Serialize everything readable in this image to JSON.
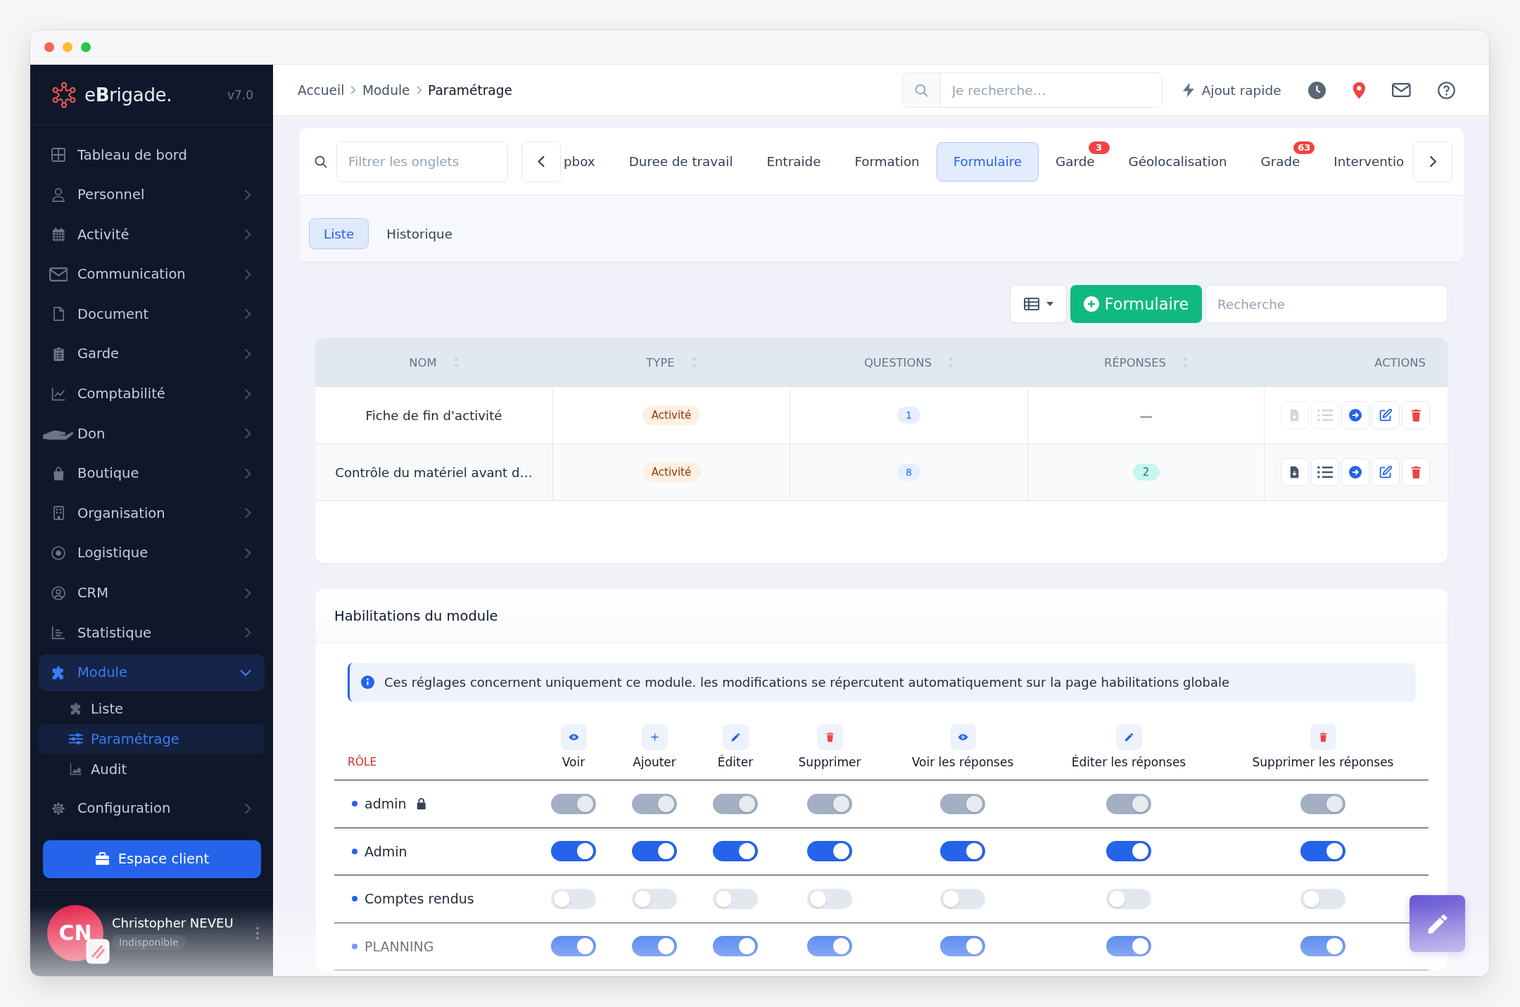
{
  "sidebar": {
    "logo": "e**B**rigade.",
    "version": "v7.0",
    "items": [
      {
        "label": "Tableau de bord",
        "kind": "link",
        "selected": false
      },
      {
        "label": "Personnel",
        "kind": "group",
        "expanded": false,
        "selected": false
      },
      {
        "label": "Activité",
        "kind": "group",
        "expanded": false,
        "selected": false
      },
      {
        "label": "Communication",
        "kind": "group",
        "expanded": false,
        "selected": false
      },
      {
        "label": "Document",
        "kind": "group",
        "expanded": false,
        "selected": false
      },
      {
        "label": "Garde",
        "kind": "group",
        "expanded": false,
        "selected": false
      },
      {
        "label": "Comptabilité",
        "kind": "group",
        "expanded": false,
        "selected": false
      },
      {
        "label": "Don",
        "kind": "group",
        "expanded": false,
        "selected": false
      },
      {
        "label": "Boutique",
        "kind": "group",
        "expanded": false,
        "selected": false
      },
      {
        "label": "Organisation",
        "kind": "group",
        "expanded": false,
        "selected": false
      },
      {
        "label": "Logistique",
        "kind": "group",
        "expanded": false,
        "selected": false
      },
      {
        "label": "CRM",
        "kind": "group",
        "expanded": false,
        "selected": false
      },
      {
        "label": "Statistique",
        "kind": "group",
        "expanded": false,
        "selected": false
      },
      {
        "label": "Module",
        "kind": "group",
        "expanded": true,
        "selected": true,
        "children": [
          {
            "label": "Liste",
            "selected": false
          },
          {
            "label": "Paramétrage",
            "selected": true
          },
          {
            "label": "Audit",
            "selected": false
          }
        ]
      },
      {
        "label": "Configuration",
        "kind": "group",
        "expanded": false,
        "selected": false
      }
    ],
    "client_button": "Espace client",
    "user": {
      "initials": "CN",
      "name": "Christopher NEVEU",
      "status": "Indisponible"
    }
  },
  "topbar": {
    "breadcrumbs": [
      "Accueil",
      "Module",
      "Paramétrage"
    ],
    "search": {
      "placeholder": "Je recherche…"
    },
    "quick_add": "Ajout rapide"
  },
  "module_tabs": {
    "filter": {
      "placeholder": "Filtrer les onglets"
    },
    "items": [
      {
        "label": "pbox",
        "selected": false
      },
      {
        "label": "Duree de travail",
        "selected": false
      },
      {
        "label": "Entraide",
        "selected": false
      },
      {
        "label": "Formation",
        "selected": false
      },
      {
        "label": "Formulaire",
        "selected": true
      },
      {
        "label": "Garde",
        "selected": false,
        "badge": "3"
      },
      {
        "label": "Géolocalisation",
        "selected": false
      },
      {
        "label": "Grade",
        "selected": false,
        "badge": "63"
      },
      {
        "label": "Interventio",
        "selected": false
      }
    ],
    "subtabs": [
      {
        "label": "Liste",
        "selected": true
      },
      {
        "label": "Historique",
        "selected": false
      }
    ]
  },
  "toolbar": {
    "add_button": "Formulaire",
    "search": {
      "placeholder": "Recherche"
    }
  },
  "table": {
    "columns": [
      {
        "label": "NOM",
        "sortable": true
      },
      {
        "label": "TYPE",
        "sortable": true
      },
      {
        "label": "QUESTIONS",
        "sortable": true
      },
      {
        "label": "RÉPONSES",
        "sortable": true
      },
      {
        "label": "ACTIONS",
        "sortable": false
      }
    ],
    "rows": [
      {
        "name": "Fiche de fin d'activité",
        "type": "Activité",
        "questions": "1",
        "responses": {
          "kind": "plain",
          "text": "—"
        },
        "actions": [
          {
            "disabled": true
          },
          {
            "disabled": true
          },
          {
            "disabled": false
          },
          {
            "disabled": false
          },
          {
            "disabled": false
          }
        ]
      },
      {
        "name": "Contrôle du matériel avant d…",
        "type": "Activité",
        "questions": "8",
        "responses": {
          "kind": "badge",
          "text": "2"
        },
        "actions": [
          {
            "disabled": false
          },
          {
            "disabled": false
          },
          {
            "disabled": false
          },
          {
            "disabled": false
          },
          {
            "disabled": false
          }
        ]
      }
    ]
  },
  "permissions": {
    "title": "Habilitations du module",
    "info": "Ces réglages concernent uniquement ce module. les modifications se répercutent automatiquement sur la page habilitations globale",
    "role_heading": "RÔLE",
    "columns": [
      {
        "label": "Voir",
        "kind": "view"
      },
      {
        "label": "Ajouter",
        "kind": "add"
      },
      {
        "label": "Éditer",
        "kind": "edit"
      },
      {
        "label": "Supprimer",
        "kind": "delete"
      },
      {
        "label": "Voir les réponses",
        "kind": "view"
      },
      {
        "label": "Éditer les réponses",
        "kind": "edit"
      },
      {
        "label": "Supprimer les réponses",
        "kind": "delete"
      }
    ],
    "roles": [
      {
        "name": "admin",
        "locked": true,
        "permissions": [
          {
            "on": true,
            "disabled": true
          },
          {
            "on": true,
            "disabled": true
          },
          {
            "on": true,
            "disabled": true
          },
          {
            "on": true,
            "disabled": true
          },
          {
            "on": true,
            "disabled": true
          },
          {
            "on": true,
            "disabled": true
          },
          {
            "on": true,
            "disabled": true
          }
        ]
      },
      {
        "name": "Admin",
        "locked": false,
        "permissions": [
          {
            "on": true,
            "disabled": false
          },
          {
            "on": true,
            "disabled": false
          },
          {
            "on": true,
            "disabled": false
          },
          {
            "on": true,
            "disabled": false
          },
          {
            "on": true,
            "disabled": false
          },
          {
            "on": true,
            "disabled": false
          },
          {
            "on": true,
            "disabled": false
          }
        ]
      },
      {
        "name": "Comptes rendus",
        "locked": false,
        "permissions": [
          {
            "on": false,
            "disabled": false
          },
          {
            "on": false,
            "disabled": false
          },
          {
            "on": false,
            "disabled": false
          },
          {
            "on": false,
            "disabled": false
          },
          {
            "on": false,
            "disabled": false
          },
          {
            "on": false,
            "disabled": false
          },
          {
            "on": false,
            "disabled": false
          }
        ]
      },
      {
        "name": "PLANNING",
        "locked": false,
        "permissions": [
          {
            "on": true,
            "disabled": false
          },
          {
            "on": true,
            "disabled": false
          },
          {
            "on": true,
            "disabled": false
          },
          {
            "on": true,
            "disabled": false
          },
          {
            "on": true,
            "disabled": false
          },
          {
            "on": true,
            "disabled": false
          },
          {
            "on": true,
            "disabled": false
          }
        ]
      }
    ]
  }
}
